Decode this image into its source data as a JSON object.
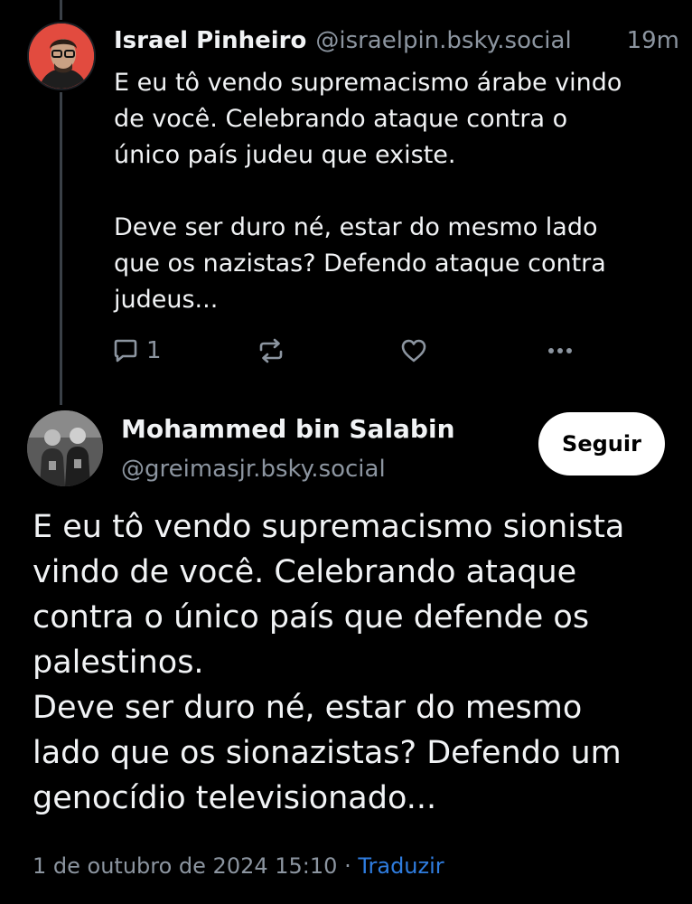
{
  "parent_post": {
    "author_name": "Israel Pinheiro",
    "author_handle": "@israelpin.bsky.social",
    "time": "19m",
    "text": "E eu tô vendo supremacismo árabe vindo\nde você. Celebrando ataque contra o\núnico país judeu que existe.\n\nDeve ser duro né, estar do mesmo lado\nque os nazistas? Defendo ataque contra\njudeus...",
    "reply_count": "1",
    "icons": [
      "reply-icon",
      "repost-icon",
      "like-icon",
      "more-icon"
    ]
  },
  "main_post": {
    "author_name": "Mohammed bin Salabin",
    "author_handle": "@greimasjr.bsky.social",
    "follow_label": "Seguir",
    "text": "E eu tô vendo supremacismo sionista\nvindo de você. Celebrando ataque\ncontra o único país que defende os\npalestinos.\nDeve ser duro né, estar do mesmo\nlado que os sionazistas? Defendo um\ngenocídio televisionado...",
    "timestamp": "1 de outubro de 2024 15:10",
    "separator": "·",
    "translate_label": "Traduzir"
  },
  "colors": {
    "background": "#000000",
    "text": "#f1f3f5",
    "muted": "#8c95a0",
    "link": "#2f7de0",
    "thread_line": "#3a4047"
  }
}
